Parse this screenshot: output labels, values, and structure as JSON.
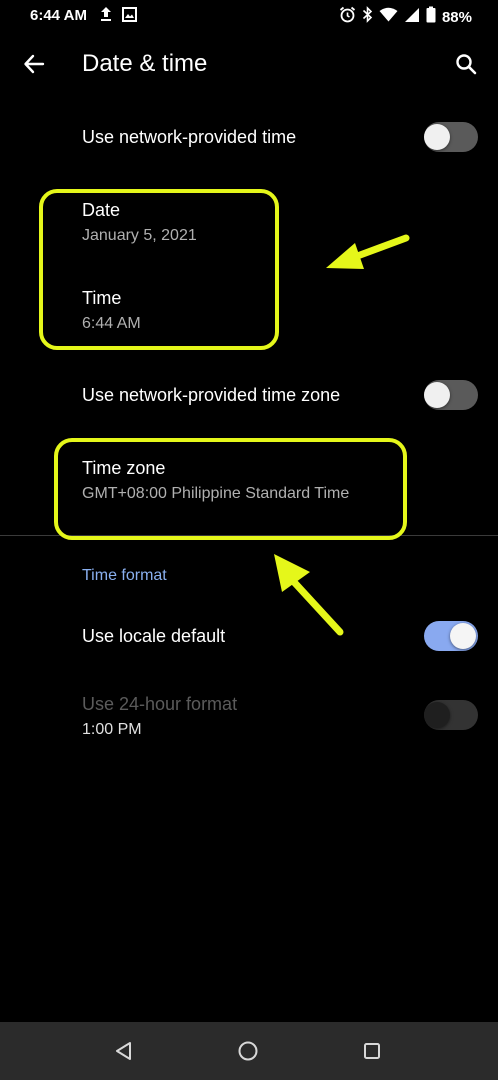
{
  "status_bar": {
    "time": "6:44 AM",
    "battery": "88%",
    "left_icons": [
      "upload-icon",
      "image-icon"
    ],
    "right_icons": [
      "alarm-icon",
      "bluetooth-icon",
      "wifi-icon",
      "signal-icon",
      "battery-icon"
    ]
  },
  "app_bar": {
    "title": "Date & time",
    "back_icon": "arrow-left-icon",
    "search_icon": "search-icon"
  },
  "settings": {
    "network_time": {
      "label": "Use network-provided time",
      "enabled": false
    },
    "date": {
      "label": "Date",
      "value": "January 5, 2021"
    },
    "time": {
      "label": "Time",
      "value": "6:44 AM"
    },
    "network_zone": {
      "label": "Use network-provided time zone",
      "enabled": false
    },
    "time_zone": {
      "label": "Time zone",
      "value": "GMT+08:00 Philippine Standard Time"
    }
  },
  "time_format": {
    "header": "Time format",
    "locale_default": {
      "label": "Use locale default",
      "enabled": true
    },
    "hour24": {
      "label": "Use 24-hour format",
      "value": "1:00 PM",
      "enabled": false,
      "disabled": true
    }
  },
  "annotations": {
    "highlight_color": "#e5f71a"
  },
  "nav_bar": {
    "icons": [
      "back-triangle-icon",
      "home-circle-icon",
      "recents-square-icon"
    ]
  },
  "colors": {
    "background": "#000000",
    "accent": "#8ab0f0",
    "toggle_on": "#89a9f0"
  }
}
